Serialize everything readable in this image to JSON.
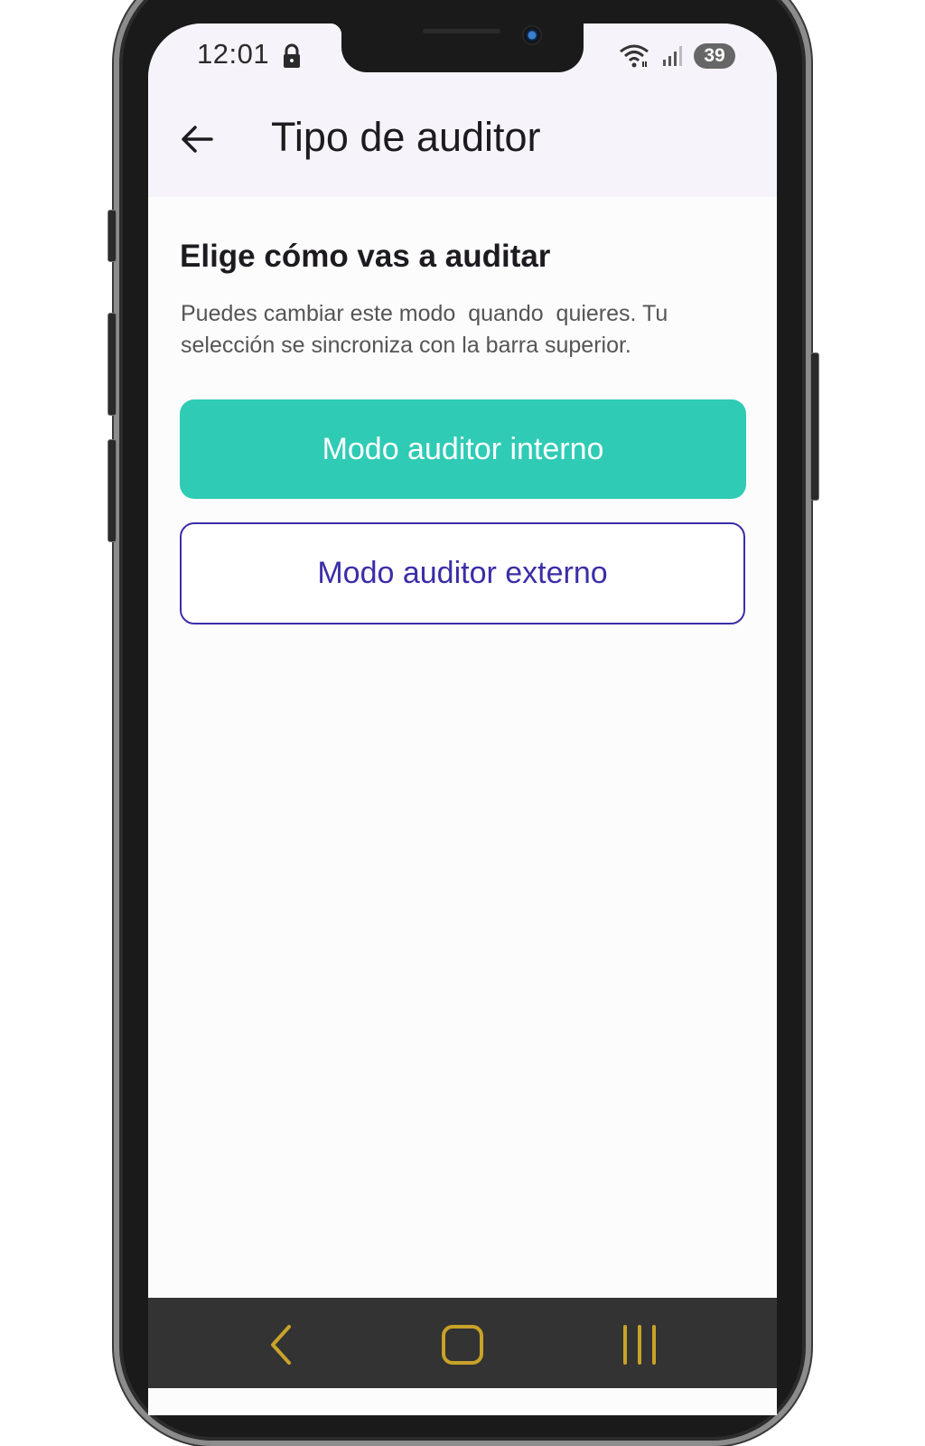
{
  "status_bar": {
    "time": "12:01",
    "battery": "39",
    "icons": [
      "lock-icon",
      "wifi-icon",
      "signal-icon",
      "battery-icon"
    ]
  },
  "app_bar": {
    "back_icon": "arrow-left-icon",
    "title": "Tipo de auditor"
  },
  "main": {
    "heading": "Elige cómo vas a auditar",
    "description": "Puedes cambiar este modo  quando  quieres. Tu selección se sincroniza con la barra superior.",
    "options": [
      {
        "label": "Modo auditor interno",
        "selected": true
      },
      {
        "label": "Modo auditor externo",
        "selected": false
      }
    ]
  },
  "nav_bar": {
    "buttons": [
      "back-chevron-icon",
      "home-square-icon",
      "recents-bars-icon"
    ]
  },
  "colors": {
    "primary_teal": "#2fcbb5",
    "outline_purple": "#3a2ea8",
    "top_bar_bg": "#f6f3fa",
    "nav_icons": "#c9a227"
  }
}
